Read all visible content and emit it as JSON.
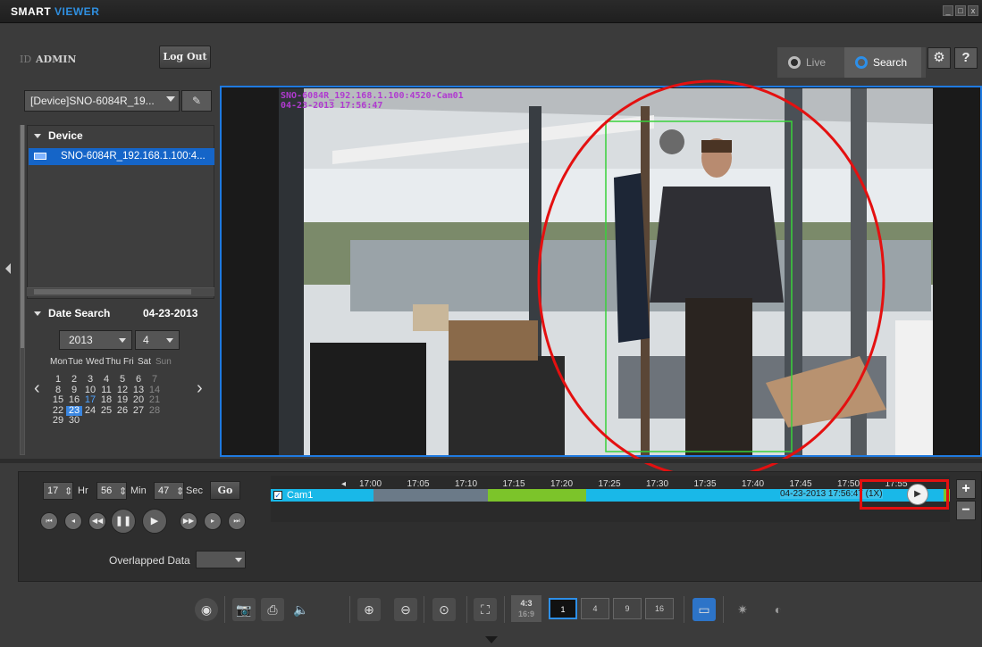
{
  "app": {
    "brand_part1": "SMART",
    "brand_part2": "VIEWER"
  },
  "window_controls": [
    "_",
    "□",
    "x"
  ],
  "header": {
    "id_label": "ID",
    "user": "ADMIN",
    "logout_label": "Log Out",
    "mode_live": "Live",
    "mode_search": "Search",
    "help_label": "?"
  },
  "left": {
    "device_select": "[Device]SNO-6084R_19...",
    "device_section": "Device",
    "device_item": "SNO-6084R_192.168.1.100:4...",
    "date_section": "Date Search",
    "date_value": "04-23-2013",
    "year": "2013",
    "month": "4",
    "weekdays": [
      "Mon",
      "Tue",
      "Wed",
      "Thu",
      "Fri",
      "Sat",
      "Sun"
    ],
    "calendar": [
      [
        "1",
        "2",
        "3",
        "4",
        "5",
        "6",
        "7"
      ],
      [
        "8",
        "9",
        "10",
        "11",
        "12",
        "13",
        "14"
      ],
      [
        "15",
        "16",
        "17",
        "18",
        "19",
        "20",
        "21"
      ],
      [
        "22",
        "23",
        "24",
        "25",
        "26",
        "27",
        "28"
      ],
      [
        "29",
        "30",
        "",
        "",
        "",
        "",
        ""
      ]
    ],
    "selected_day": "23",
    "highlighted_day": "17"
  },
  "video": {
    "overlay_line1": "SNO-6084R_192.168.1.100:4520-Cam01",
    "overlay_line2": "04-23-2013 17:56:47"
  },
  "playback": {
    "hour": "17",
    "hour_label": "Hr",
    "min": "56",
    "min_label": "Min",
    "sec": "47",
    "sec_label": "Sec",
    "go_label": "Go",
    "overlapped_label": "Overlapped Data",
    "overlapped_value": ""
  },
  "timeline": {
    "ticks": [
      "17:00",
      "17:05",
      "17:10",
      "17:15",
      "17:20",
      "17:25",
      "17:30",
      "17:35",
      "17:40",
      "17:45",
      "17:50",
      "17:55"
    ],
    "camera": "Cam1",
    "timestamp": "04-23-2013 17:56:47 (1X)",
    "zoom_in": "+",
    "zoom_out": "−",
    "colors": {
      "recorded": "#19b8e8",
      "event": "#7cc42a",
      "empty": "#1d2a3a"
    }
  },
  "toolbar": {
    "ratio_top": "4:3",
    "ratio_bottom": "16:9",
    "layouts": [
      "1",
      "4",
      "9",
      "16"
    ]
  }
}
